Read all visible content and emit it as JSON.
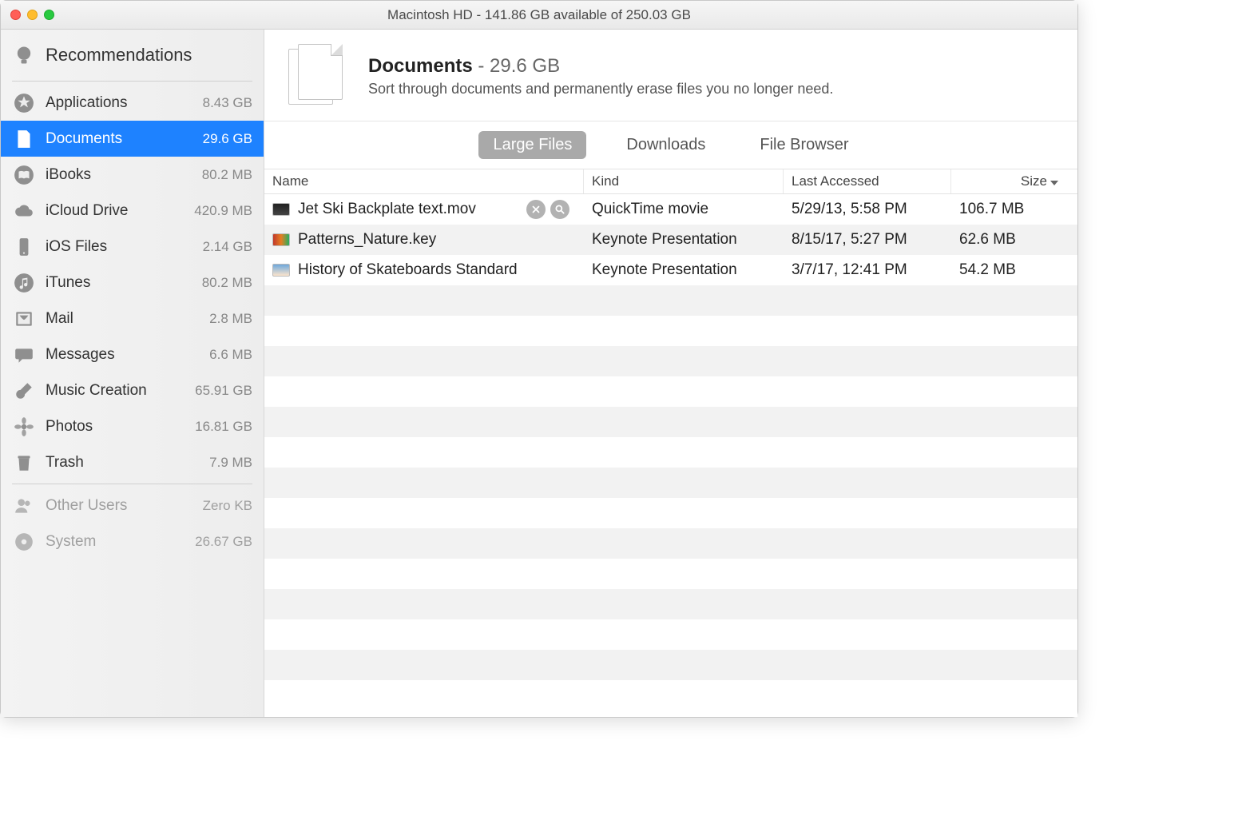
{
  "titlebar": {
    "title": "Macintosh HD - 141.86 GB available of 250.03 GB"
  },
  "sidebar": {
    "recommendations_label": "Recommendations",
    "items": [
      {
        "label": "Applications",
        "size": "8.43 GB"
      },
      {
        "label": "Documents",
        "size": "29.6 GB"
      },
      {
        "label": "iBooks",
        "size": "80.2 MB"
      },
      {
        "label": "iCloud Drive",
        "size": "420.9 MB"
      },
      {
        "label": "iOS Files",
        "size": "2.14 GB"
      },
      {
        "label": "iTunes",
        "size": "80.2 MB"
      },
      {
        "label": "Mail",
        "size": "2.8 MB"
      },
      {
        "label": "Messages",
        "size": "6.6 MB"
      },
      {
        "label": "Music Creation",
        "size": "65.91 GB"
      },
      {
        "label": "Photos",
        "size": "16.81 GB"
      },
      {
        "label": "Trash",
        "size": "7.9 MB"
      }
    ],
    "footer": [
      {
        "label": "Other Users",
        "size": "Zero KB"
      },
      {
        "label": "System",
        "size": "26.67 GB"
      }
    ]
  },
  "header": {
    "title": "Documents",
    "dash": " - ",
    "size": "29.6 GB",
    "subtitle": "Sort through documents and permanently erase files you no longer need."
  },
  "tabs": {
    "large": "Large Files",
    "downloads": "Downloads",
    "browser": "File Browser"
  },
  "table": {
    "columns": {
      "name": "Name",
      "kind": "Kind",
      "last": "Last Accessed",
      "size": "Size"
    },
    "rows": [
      {
        "name": "Jet Ski Backplate text.mov",
        "kind": "QuickTime movie",
        "last": "5/29/13, 5:58 PM",
        "size": "106.7 MB"
      },
      {
        "name": "Patterns_Nature.key",
        "kind": "Keynote Presentation",
        "last": "8/15/17, 5:27 PM",
        "size": "62.6 MB"
      },
      {
        "name": "History of Skateboards Standard",
        "kind": "Keynote Presentation",
        "last": "3/7/17, 12:41 PM",
        "size": "54.2 MB"
      }
    ]
  }
}
